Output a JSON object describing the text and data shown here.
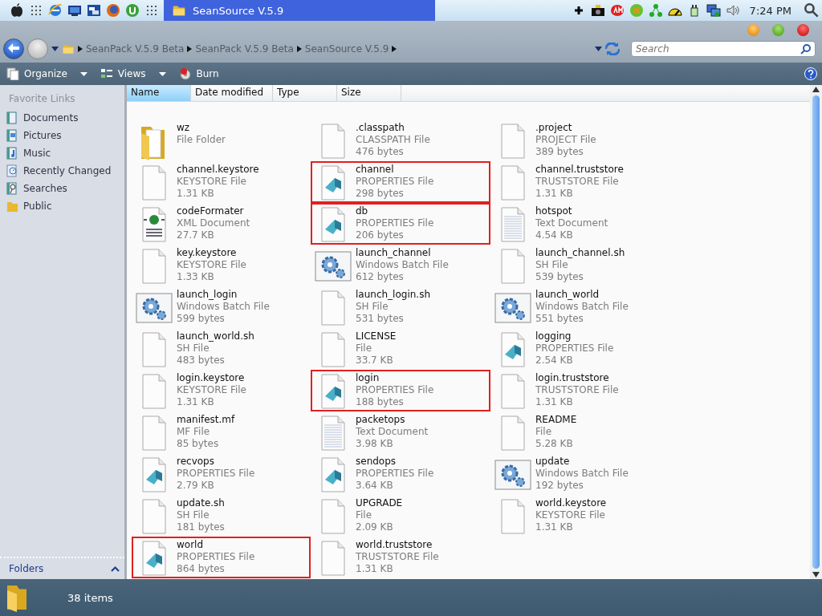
{
  "menubar": {
    "task": {
      "title": "SeanSource V.5.9",
      "selected": true
    },
    "clock": "7:24 PM"
  },
  "window": {
    "breadcrumbs": [
      "SeanPack V.5.9 Beta",
      "SeanPack V.5.9 Beta",
      "SeanSource V.5.9"
    ],
    "search": {
      "placeholder": "Search"
    }
  },
  "toolbar": {
    "buttons": [
      {
        "label": "Organize",
        "kind": "organize",
        "dropdown": true
      },
      {
        "label": "Views",
        "kind": "views",
        "dropdown": true
      },
      {
        "label": "Burn",
        "kind": "burn",
        "dropdown": false
      }
    ]
  },
  "sidebar": {
    "heading": "Favorite Links",
    "items": [
      {
        "label": "Documents",
        "kind": "documents"
      },
      {
        "label": "Pictures",
        "kind": "pictures"
      },
      {
        "label": "Music",
        "kind": "music"
      },
      {
        "label": "Recently Changed",
        "kind": "recent"
      },
      {
        "label": "Searches",
        "kind": "searches"
      },
      {
        "label": "Public",
        "kind": "public"
      }
    ],
    "folders": "Folders"
  },
  "columns": [
    {
      "label": "Name",
      "selected": true
    },
    {
      "label": "Date modified",
      "selected": false
    },
    {
      "label": "Type",
      "selected": false
    },
    {
      "label": "Size",
      "selected": false
    }
  ],
  "files": [
    {
      "name": "wz",
      "type": "File Folder",
      "kind": "folder",
      "highlighted": false
    },
    {
      "name": ".classpath",
      "type": "CLASSPATH File",
      "size": "476 bytes",
      "kind": "blank",
      "highlighted": false
    },
    {
      "name": ".project",
      "type": "PROJECT File",
      "size": "389 bytes",
      "kind": "blank",
      "highlighted": false
    },
    {
      "name": "channel.keystore",
      "type": "KEYSTORE File",
      "size": "1.31 KB",
      "kind": "blank",
      "highlighted": false
    },
    {
      "name": "channel",
      "type": "PROPERTIES File",
      "size": "298 bytes",
      "kind": "props",
      "highlighted": true
    },
    {
      "name": "channel.truststore",
      "type": "TRUSTSTORE File",
      "size": "1.31 KB",
      "kind": "blank",
      "highlighted": false
    },
    {
      "name": "codeFormater",
      "type": "XML Document",
      "size": "27.7 KB",
      "kind": "xml",
      "highlighted": false
    },
    {
      "name": "db",
      "type": "PROPERTIES File",
      "size": "206 bytes",
      "kind": "props",
      "highlighted": true
    },
    {
      "name": "hotspot",
      "type": "Text Document",
      "size": "4.54 KB",
      "kind": "text",
      "highlighted": false
    },
    {
      "name": "key.keystore",
      "type": "KEYSTORE File",
      "size": "1.33 KB",
      "kind": "blank",
      "highlighted": false
    },
    {
      "name": "launch_channel",
      "type": "Windows Batch File",
      "size": "612 bytes",
      "kind": "batch",
      "highlighted": false
    },
    {
      "name": "launch_channel.sh",
      "type": "SH File",
      "size": "539 bytes",
      "kind": "blank",
      "highlighted": false
    },
    {
      "name": "launch_login",
      "type": "Windows Batch File",
      "size": "599 bytes",
      "kind": "batch",
      "highlighted": false
    },
    {
      "name": "launch_login.sh",
      "type": "SH File",
      "size": "531 bytes",
      "kind": "blank",
      "highlighted": false
    },
    {
      "name": "launch_world",
      "type": "Windows Batch File",
      "size": "551 bytes",
      "kind": "batch",
      "highlighted": false
    },
    {
      "name": "launch_world.sh",
      "type": "SH File",
      "size": "483 bytes",
      "kind": "blank",
      "highlighted": false
    },
    {
      "name": "LICENSE",
      "type": "File",
      "size": "33.7 KB",
      "kind": "blank",
      "highlighted": false
    },
    {
      "name": "logging",
      "type": "PROPERTIES File",
      "size": "2.54 KB",
      "kind": "props",
      "highlighted": false
    },
    {
      "name": "login.keystore",
      "type": "KEYSTORE File",
      "size": "1.31 KB",
      "kind": "blank",
      "highlighted": false
    },
    {
      "name": "login",
      "type": "PROPERTIES File",
      "size": "188 bytes",
      "kind": "props",
      "highlighted": true
    },
    {
      "name": "login.truststore",
      "type": "TRUSTSTORE File",
      "size": "1.31 KB",
      "kind": "blank",
      "highlighted": false
    },
    {
      "name": "manifest.mf",
      "type": "MF File",
      "size": "85 bytes",
      "kind": "blank",
      "highlighted": false
    },
    {
      "name": "packetops",
      "type": "Text Document",
      "size": "3.98 KB",
      "kind": "text",
      "highlighted": false
    },
    {
      "name": "README",
      "type": "File",
      "size": "5.28 KB",
      "kind": "blank",
      "highlighted": false
    },
    {
      "name": "recvops",
      "type": "PROPERTIES File",
      "size": "2.79 KB",
      "kind": "props",
      "highlighted": false
    },
    {
      "name": "sendops",
      "type": "PROPERTIES File",
      "size": "3.64 KB",
      "kind": "props",
      "highlighted": false
    },
    {
      "name": "update",
      "type": "Windows Batch File",
      "size": "192 bytes",
      "kind": "batch",
      "highlighted": false
    },
    {
      "name": "update.sh",
      "type": "SH File",
      "size": "181 bytes",
      "kind": "blank",
      "highlighted": false
    },
    {
      "name": "UPGRADE",
      "type": "File",
      "size": "2.09 KB",
      "kind": "blank",
      "highlighted": false
    },
    {
      "name": "world.keystore",
      "type": "KEYSTORE File",
      "size": "1.31 KB",
      "kind": "blank",
      "highlighted": false
    },
    {
      "name": "world",
      "type": "PROPERTIES File",
      "size": "864 bytes",
      "kind": "props",
      "highlighted": true
    },
    {
      "name": "world.truststore",
      "type": "TRUSTSTORE File",
      "size": "1.31 KB",
      "kind": "blank",
      "highlighted": false
    }
  ],
  "status_bar": {
    "count": "38 items"
  }
}
